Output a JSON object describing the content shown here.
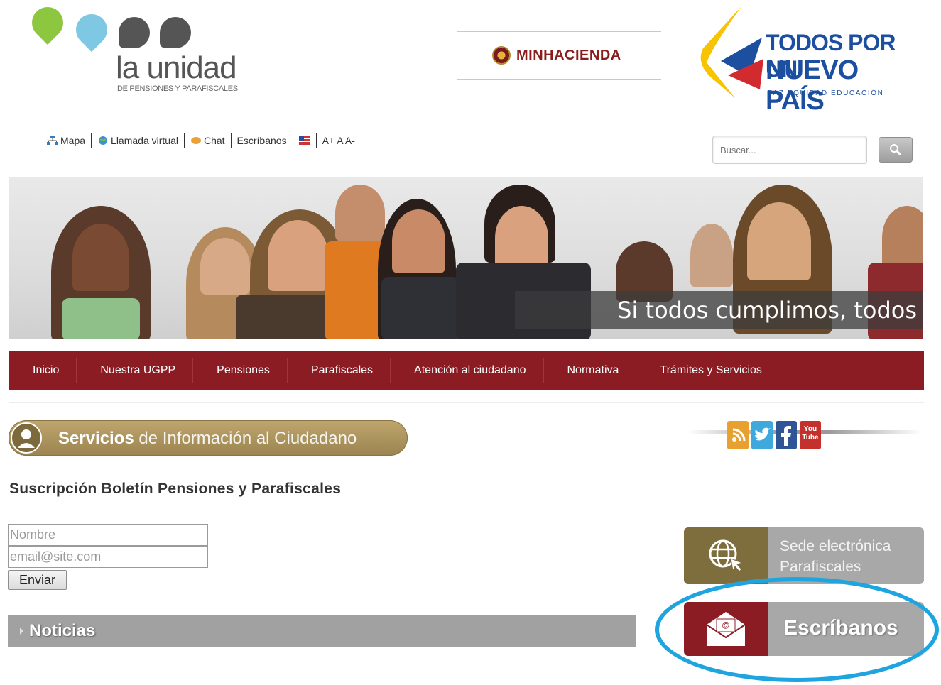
{
  "header": {
    "logo_title": "la unidad",
    "logo_subtitle": "DE PENSIONES Y PARAFISCALES",
    "minhacienda": "MINHACIENDA",
    "slogan_line1": "TODOS POR UN",
    "slogan_line2": "NUEVO PAÍS",
    "slogan_line3": "PAZ  EQUIDAD  EDUCACIÓN"
  },
  "toolbar": {
    "items": [
      {
        "label": "Mapa",
        "icon": "sitemap-icon"
      },
      {
        "label": "Llamada virtual",
        "icon": "globe-phone-icon"
      },
      {
        "label": "Chat",
        "icon": "chat-icon"
      },
      {
        "label": "Escríbanos",
        "icon": ""
      },
      {
        "label": "",
        "icon": "flag-icon"
      },
      {
        "label": "A+ A A-",
        "icon": ""
      }
    ]
  },
  "search": {
    "placeholder": "Buscar..."
  },
  "banner": {
    "caption": "Si todos cumplimos, todos ganamos"
  },
  "nav": {
    "items": [
      "Inicio",
      "Nuestra UGPP",
      "Pensiones",
      "Parafiscales",
      "Atención al ciudadano",
      "Normativa",
      "Trámites y Servicios"
    ]
  },
  "services": {
    "bold": "Servicios",
    "rest": "de Información al Ciudadano"
  },
  "social": {
    "icons": [
      "rss-icon",
      "twitter-icon",
      "facebook-icon",
      "youtube-icon"
    ],
    "youtube_text": "You Tube"
  },
  "subscription": {
    "title": "Suscripción Boletín Pensiones y Parafiscales",
    "name_placeholder": "Nombre",
    "email_placeholder": "email@site.com",
    "submit_label": "Enviar"
  },
  "news": {
    "title": "Noticias"
  },
  "sede": {
    "line1": "Sede electrónica",
    "line2": "Parafiscales"
  },
  "escribanos": {
    "label": "Escríbanos"
  },
  "colors": {
    "brand_red": "#8c1c24",
    "gold": "#a38b56",
    "gray": "#a8a8a8",
    "highlight": "#1ea5e0"
  }
}
